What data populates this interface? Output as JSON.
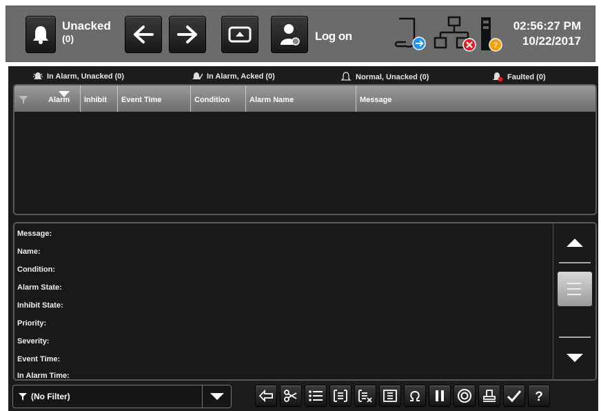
{
  "header": {
    "unacked_label": "Unacked",
    "unacked_count": "(0)",
    "logon_label": "Log on",
    "time": "02:56:27 PM",
    "date": "10/22/2017"
  },
  "tabs": [
    {
      "label": "In Alarm, Unacked (0)",
      "icon": "alarm-unacked-icon"
    },
    {
      "label": "In Alarm, Acked (0)",
      "icon": "alarm-acked-icon"
    },
    {
      "label": "Normal, Unacked (0)",
      "icon": "bell-icon"
    },
    {
      "label": "Faulted (0)",
      "icon": "faulted-bell-icon"
    }
  ],
  "table": {
    "columns": [
      "Alarm",
      "Inhibit",
      "Event Time",
      "Condition",
      "Alarm Name",
      "Message"
    ]
  },
  "details": {
    "fields": [
      "Message:",
      "Name:",
      "Condition:",
      "Alarm State:",
      "Inhibit State:",
      "Priority:",
      "Severity:",
      "Event Time:",
      "In Alarm Time:"
    ]
  },
  "filter": {
    "label": "(No Filter)"
  },
  "colors": {
    "panel_bg": "#1b1b1b",
    "header_bg": "#6b6b6b",
    "status_blue": "#1e90ff",
    "status_red": "#e02020",
    "status_orange": "#f5a000"
  }
}
